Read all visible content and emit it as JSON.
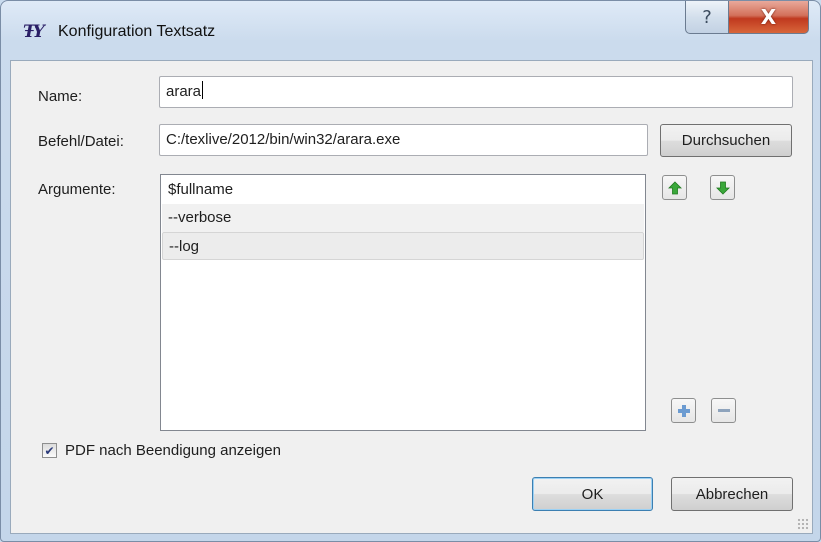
{
  "window": {
    "title": "Konfiguration Textsatz",
    "help_glyph": "?",
    "close_glyph": "X"
  },
  "form": {
    "name_label": "Name:",
    "name_value": "arara",
    "command_label": "Befehl/Datei:",
    "command_value": "C:/texlive/2012/bin/win32/arara.exe",
    "browse_button": "Durchsuchen",
    "arguments_label": "Argumente:",
    "arguments": [
      "$fullname",
      "--verbose",
      "--log"
    ],
    "selected_argument_index": 2
  },
  "icons": {
    "move_up": "arrow-up-icon",
    "move_down": "arrow-down-icon",
    "add": "plus-icon",
    "remove": "minus-icon",
    "app": "texmaker-icon",
    "arrow_color": "#3aa83a",
    "plus_color": "#6b9bd1"
  },
  "options": {
    "show_pdf_label": "PDF nach Beendigung anzeigen",
    "show_pdf_checked": true
  },
  "footer": {
    "ok_label": "OK",
    "cancel_label": "Abbrechen"
  }
}
